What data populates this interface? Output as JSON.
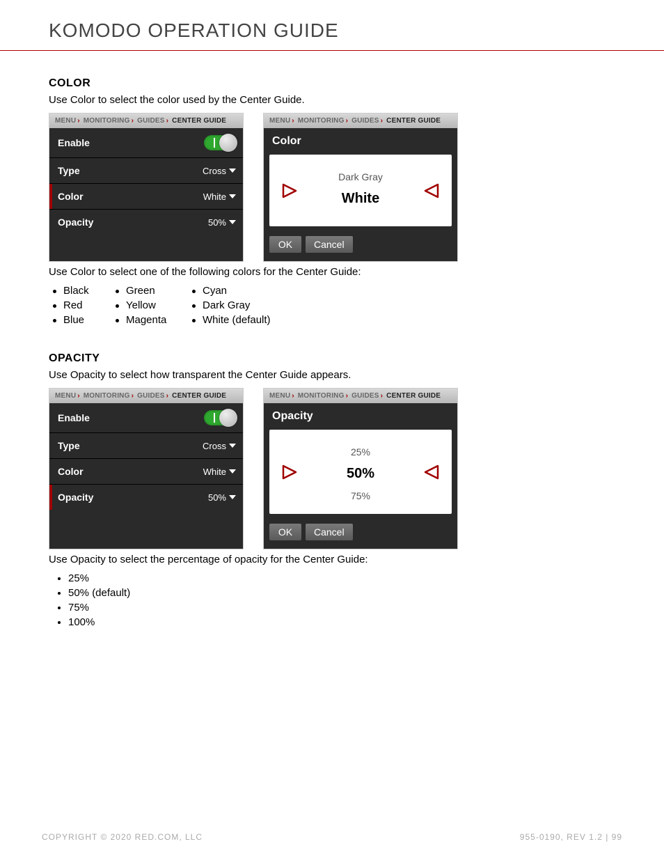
{
  "header": {
    "title": "KOMODO OPERATION GUIDE"
  },
  "sections": {
    "color": {
      "heading": "COLOR",
      "intro": "Use Color to select the color used by the Center Guide.",
      "after": "Use Color to select one of the following colors for the Center Guide:"
    },
    "opacity": {
      "heading": "OPACITY",
      "intro": "Use Opacity to select how transparent the Center Guide appears.",
      "after": "Use Opacity to select the percentage of opacity for the Center Guide:"
    }
  },
  "breadcrumb": {
    "a": "MENU",
    "b": "MONITORING",
    "c": "GUIDES",
    "d": "CENTER GUIDE"
  },
  "menu": {
    "enable": "Enable",
    "type": "Type",
    "type_val": "Cross",
    "color": "Color",
    "color_val": "White",
    "opacity": "Opacity",
    "opacity_val": "50%"
  },
  "picker": {
    "color": {
      "title": "Color",
      "above": "Dark Gray",
      "selected": "White"
    },
    "opacity": {
      "title": "Opacity",
      "above": "25%",
      "selected": "50%",
      "below": "75%"
    },
    "ok": "OK",
    "cancel": "Cancel"
  },
  "color_options": {
    "c0": "Black",
    "c1": "Green",
    "c2": "Cyan",
    "c3": "Red",
    "c4": "Yellow",
    "c5": "Dark Gray",
    "c6": "Blue",
    "c7": "Magenta",
    "c8": "White (default)"
  },
  "opacity_options": {
    "o0": "25%",
    "o1": "50% (default)",
    "o2": "75%",
    "o3": "100%"
  },
  "footer": {
    "left": "COPYRIGHT © 2020 RED.COM, LLC",
    "right": "955-0190, REV 1.2  |  99"
  }
}
